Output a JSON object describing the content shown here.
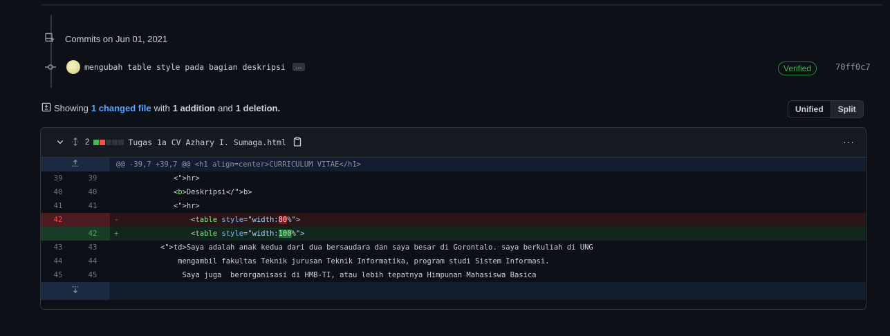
{
  "commits": {
    "heading": "Commits on Jun 01, 2021",
    "items": [
      {
        "message": "mengubah table style pada bagian deskripsi",
        "ellipsis": "…",
        "verified": "Verified",
        "sha": "70ff0c7"
      }
    ]
  },
  "summary": {
    "prefix": "Showing",
    "changed": "1 changed file",
    "middle1": "with",
    "additions": "1 addition",
    "middle2": "and",
    "deletions": "1 deletion."
  },
  "view_toggle": {
    "unified": "Unified",
    "split": "Split"
  },
  "file": {
    "change_count": "2",
    "name": "Tugas 1a CV Azhary I. Sumaga.html",
    "hunk_header": "@@ -39,7 +39,7 @@ <h1 align=center>CURRICULUM VITAE</h1>",
    "lines": [
      {
        "old": "39",
        "new": "39",
        "type": "ctx",
        "text": "            <hr>"
      },
      {
        "old": "40",
        "new": "40",
        "type": "ctx",
        "text": "            <b>Deskripsi</b>"
      },
      {
        "old": "41",
        "new": "41",
        "type": "ctx",
        "text": "            <hr>"
      },
      {
        "old": "42",
        "new": "",
        "type": "del",
        "sign": "-",
        "pre": "                <table style=\"width:",
        "hl": "80",
        "post": "%\">"
      },
      {
        "old": "",
        "new": "42",
        "type": "add",
        "sign": "+",
        "pre": "                <table style=\"width:",
        "hl": "100",
        "post": "%\">"
      },
      {
        "old": "43",
        "new": "43",
        "type": "ctx",
        "text": "         <td>Saya adalah anak kedua dari dua bersaudara dan saya besar di Gorontalo. saya berkuliah di UNG"
      },
      {
        "old": "44",
        "new": "44",
        "type": "ctx",
        "text": "             mengambil fakultas Teknik jurusan Teknik Informatika, program studi Sistem Informasi."
      },
      {
        "old": "45",
        "new": "45",
        "type": "ctx",
        "text": "              Saya juga  berorganisasi di HMB-TI, atau lebih tepatnya Himpunan Mahasiswa Basica"
      }
    ]
  },
  "colors": {
    "added": "#3fb950",
    "deleted": "#f85149",
    "link": "#58a6ff"
  }
}
